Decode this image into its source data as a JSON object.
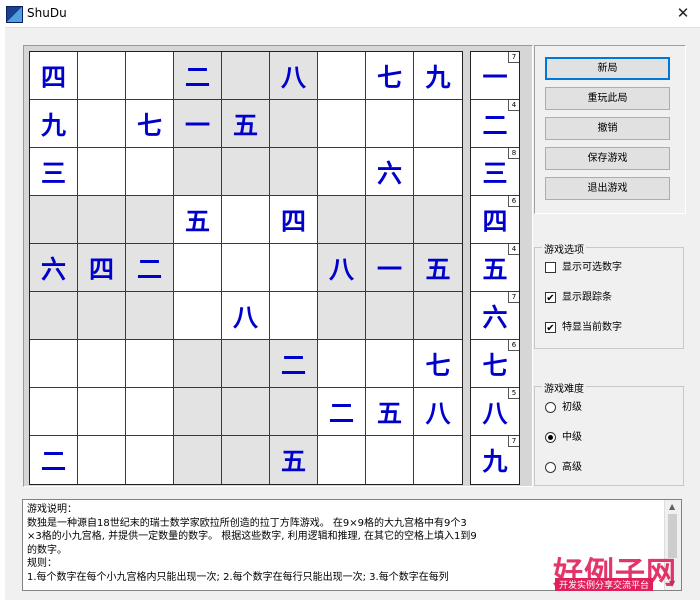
{
  "window": {
    "title": "ShuDu",
    "close_glyph": "✕"
  },
  "board": {
    "rows": [
      [
        "四",
        "",
        "",
        "二",
        "",
        "八",
        "",
        "七",
        "九"
      ],
      [
        "九",
        "",
        "七",
        "一",
        "五",
        "",
        "",
        "",
        ""
      ],
      [
        "三",
        "",
        "",
        "",
        "",
        "",
        "",
        "六",
        ""
      ],
      [
        "",
        "",
        "",
        "五",
        "",
        "四",
        "",
        "",
        ""
      ],
      [
        "六",
        "四",
        "二",
        "",
        "",
        "",
        "八",
        "一",
        "五"
      ],
      [
        "",
        "",
        "",
        "",
        "八",
        "",
        "",
        "",
        ""
      ],
      [
        "",
        "",
        "",
        "",
        "",
        "二",
        "",
        "",
        "七"
      ],
      [
        "",
        "",
        "",
        "",
        "",
        "",
        "二",
        "五",
        "八"
      ],
      [
        "二",
        "",
        "",
        "",
        "",
        "五",
        "",
        "",
        ""
      ]
    ]
  },
  "side_panel": {
    "items": [
      {
        "num": "一",
        "count": "7"
      },
      {
        "num": "二",
        "count": "4"
      },
      {
        "num": "三",
        "count": "8"
      },
      {
        "num": "四",
        "count": "6"
      },
      {
        "num": "五",
        "count": "4"
      },
      {
        "num": "六",
        "count": "7"
      },
      {
        "num": "七",
        "count": "6"
      },
      {
        "num": "八",
        "count": "5"
      },
      {
        "num": "九",
        "count": "7"
      }
    ]
  },
  "buttons": {
    "new_game": "新局",
    "replay": "重玩此局",
    "undo": "撤销",
    "save": "保存游戏",
    "exit": "退出游戏"
  },
  "options": {
    "legend": "游戏选项",
    "show_candidates": {
      "label": "显示可选数字",
      "checked": false
    },
    "show_trace": {
      "label": "显示跟踪条",
      "checked": true
    },
    "highlight_current": {
      "label": "特显当前数字",
      "checked": true
    }
  },
  "difficulty": {
    "legend": "游戏难度",
    "easy": {
      "label": "初级",
      "selected": false
    },
    "medium": {
      "label": "中级",
      "selected": true
    },
    "hard": {
      "label": "高级",
      "selected": false
    }
  },
  "description": {
    "lines": [
      "游戏说明：",
      "     数独是一种源自18世纪末的瑞士数学家欧拉所创造的拉丁方阵游戏。 在9×9格的大九宫格中有9个3",
      "×3格的小九宫格, 并提供一定数量的数字。 根据这些数字, 利用逻辑和推理, 在其它的空格上填入1到9",
      "的数字。",
      "规则：",
      "  1.每个数字在每个小九宫格内只能出现一次; 2.每个数字在每行只能出现一次; 3.每个数字在每列"
    ]
  },
  "watermark": {
    "brand": "好例子网",
    "tagline": "开发实例分享交流平台"
  }
}
